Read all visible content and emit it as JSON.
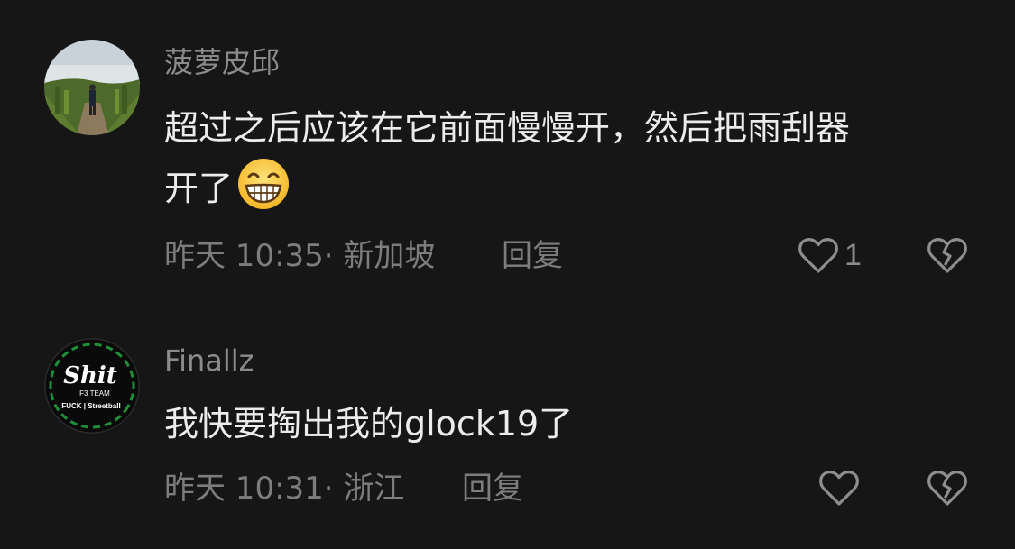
{
  "comments": [
    {
      "username": "菠萝皮邱",
      "text_line1": "超过之后应该在它前面慢慢开，然后把雨刮器",
      "text_line2": "开了",
      "emoji": "grinning-face-emoji",
      "time": "昨天 10:35",
      "location": "新加坡",
      "meta": "昨天 10:35· 新加坡",
      "reply_label": "回复",
      "like_count": "1",
      "avatar_icon": "landscape-photo-avatar"
    },
    {
      "username": "Finallz",
      "text_line1": "我快要掏出我的glock19了",
      "time": "昨天 10:31",
      "location": "浙江",
      "meta": "昨天 10:31· 浙江",
      "reply_label": "回复",
      "like_count": "",
      "avatar_icon": "shit-f3-team-logo-avatar",
      "avatar_text": {
        "title": "Shit",
        "sub": "F3 TEAM",
        "bottom": "FUCK | Streetball"
      }
    }
  ],
  "colors": {
    "background": "#161616",
    "username": "#8b8b8b",
    "text": "#ececec",
    "meta": "#7d7d7d"
  }
}
